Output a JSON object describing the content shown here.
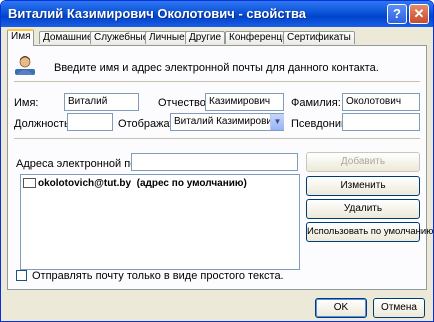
{
  "window": {
    "title": "Виталий Казимирович Околотович - свойства",
    "help_label": "?",
    "close_label": "✕"
  },
  "tabs": [
    "Имя",
    "Домашние",
    "Служебные",
    "Личные",
    "Другие",
    "Конференция",
    "Сертификаты"
  ],
  "intro_text": "Введите имя и адрес электронной почты для данного контакта.",
  "form": {
    "first_name_label": "Имя:",
    "first_name_value": "Виталий",
    "middle_name_label": "Отчество:",
    "middle_name_value": "Казимирович",
    "last_name_label": "Фамилия:",
    "last_name_value": "Околотович",
    "title_label": "Должность:",
    "title_value": "",
    "display_label": "Отображать:",
    "display_value": "Виталий Казимирович Ок",
    "nickname_label": "Псевдоним:",
    "nickname_value": ""
  },
  "email": {
    "label": "Адреса электронной почты:",
    "input_value": "",
    "add_button": "Добавить",
    "items": [
      {
        "address": "okolotovich@tut.by",
        "note": "(адрес по умолчанию)"
      }
    ],
    "edit_button": "Изменить",
    "remove_button": "Удалить",
    "default_button": "Использовать по умолчанию"
  },
  "plain_text": {
    "label": "Отправлять почту только в виде простого текста.",
    "checked": false
  },
  "footer": {
    "ok": "OK",
    "cancel": "Отмена"
  }
}
